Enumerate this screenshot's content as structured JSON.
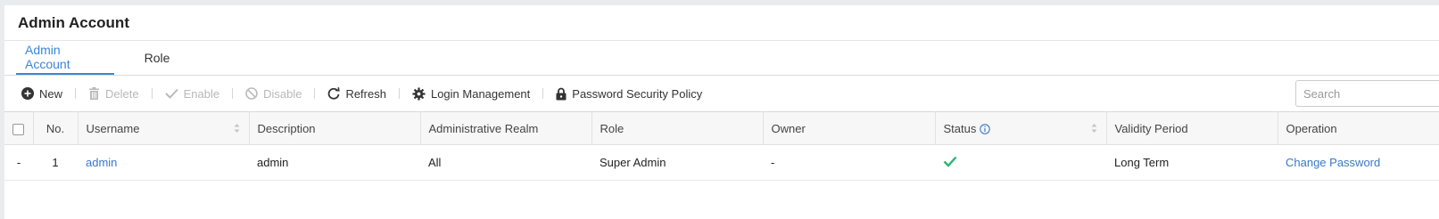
{
  "page": {
    "title": "Admin Account"
  },
  "tabs": [
    {
      "label": "Admin Account",
      "active": true
    },
    {
      "label": "Role",
      "active": false
    }
  ],
  "toolbar": {
    "new_label": "New",
    "delete_label": "Delete",
    "enable_label": "Enable",
    "disable_label": "Disable",
    "refresh_label": "Refresh",
    "login_management_label": "Login Management",
    "password_policy_label": "Password Security Policy",
    "search_placeholder": "Search"
  },
  "table": {
    "columns": {
      "no": "No.",
      "username": "Username",
      "description": "Description",
      "realm": "Administrative Realm",
      "role": "Role",
      "owner": "Owner",
      "status": "Status",
      "validity": "Validity Period",
      "operation": "Operation"
    },
    "rows": [
      {
        "expand": "-",
        "no": "1",
        "username": "admin",
        "description": "admin",
        "realm": "All",
        "role": "Super Admin",
        "owner": "-",
        "status_icon": "check-icon",
        "validity": "Long Term",
        "operation": "Change Password"
      }
    ]
  },
  "colors": {
    "accent": "#3a86d8",
    "link": "#3a78c7",
    "status_ok": "#2bb673"
  }
}
